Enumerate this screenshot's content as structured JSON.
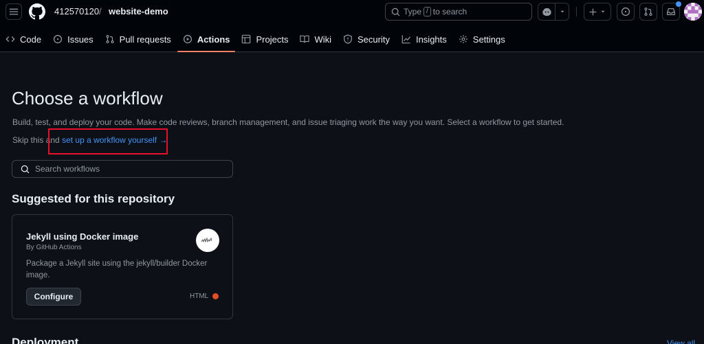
{
  "repo": {
    "owner": "412570120",
    "separator": "/",
    "name": "website-demo"
  },
  "search": {
    "prefix": "Type",
    "key": "/",
    "suffix": "to search"
  },
  "tabs": [
    {
      "label": "Code",
      "icon": "code-icon"
    },
    {
      "label": "Issues",
      "icon": "issue-opened-icon"
    },
    {
      "label": "Pull requests",
      "icon": "git-pull-request-icon"
    },
    {
      "label": "Actions",
      "icon": "play-icon",
      "active": true
    },
    {
      "label": "Projects",
      "icon": "table-icon"
    },
    {
      "label": "Wiki",
      "icon": "book-icon"
    },
    {
      "label": "Security",
      "icon": "shield-icon"
    },
    {
      "label": "Insights",
      "icon": "graph-icon"
    },
    {
      "label": "Settings",
      "icon": "gear-icon"
    }
  ],
  "page": {
    "title": "Choose a workflow",
    "description": "Build, test, and deploy your code. Make code reviews, branch management, and issue triaging work the way you want. Select a workflow to get started.",
    "skip_prefix": "Skip this and",
    "skip_link": "set up a workflow yourself",
    "skip_arrow": "→",
    "search_placeholder": "Search workflows",
    "suggested_heading": "Suggested for this repository",
    "next_section_heading": "Deployment",
    "view_all": "View all"
  },
  "card": {
    "title": "Jekyll using Docker image",
    "author": "By GitHub Actions",
    "description": "Package a Jekyll site using the jekyll/builder Docker image.",
    "button": "Configure",
    "language": "HTML",
    "language_color": "#e34c26"
  },
  "colors": {
    "accent_link": "#4493f8",
    "active_tab_underline": "#f78166",
    "highlight_box": "#e8102b",
    "notification_dot": "#4493f8"
  }
}
